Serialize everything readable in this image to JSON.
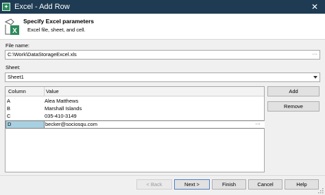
{
  "window": {
    "title": "Excel - Add Row",
    "close_glyph": "✕"
  },
  "header": {
    "title": "Specify Excel parameters",
    "subtitle": "Excel file, sheet, and cell.",
    "icon_letter": "X"
  },
  "file": {
    "label": "File name:",
    "value": "C:\\Work\\DataStorageExcel.xls",
    "browse_glyph": "···"
  },
  "sheet": {
    "label": "Sheet:",
    "value": "Sheet1"
  },
  "grid": {
    "columns": [
      "Column",
      "Value"
    ],
    "rows": [
      {
        "column": "A",
        "value": "Alea Matthews"
      },
      {
        "column": "B",
        "value": "Marshall Islands"
      },
      {
        "column": "C",
        "value": "035-410-3149"
      },
      {
        "column": "D",
        "value": "becker@sociosqu.com"
      }
    ],
    "edit_glyph": "···"
  },
  "side_buttons": {
    "add": "Add",
    "remove": "Remove"
  },
  "footer": {
    "back": "< Back",
    "next": "Next >",
    "finish": "Finish",
    "cancel": "Cancel",
    "help": "Help"
  },
  "colors": {
    "titlebar": "#1f3b53",
    "selection": "#a9d0e0",
    "excel_green": "#2d8a5a"
  }
}
